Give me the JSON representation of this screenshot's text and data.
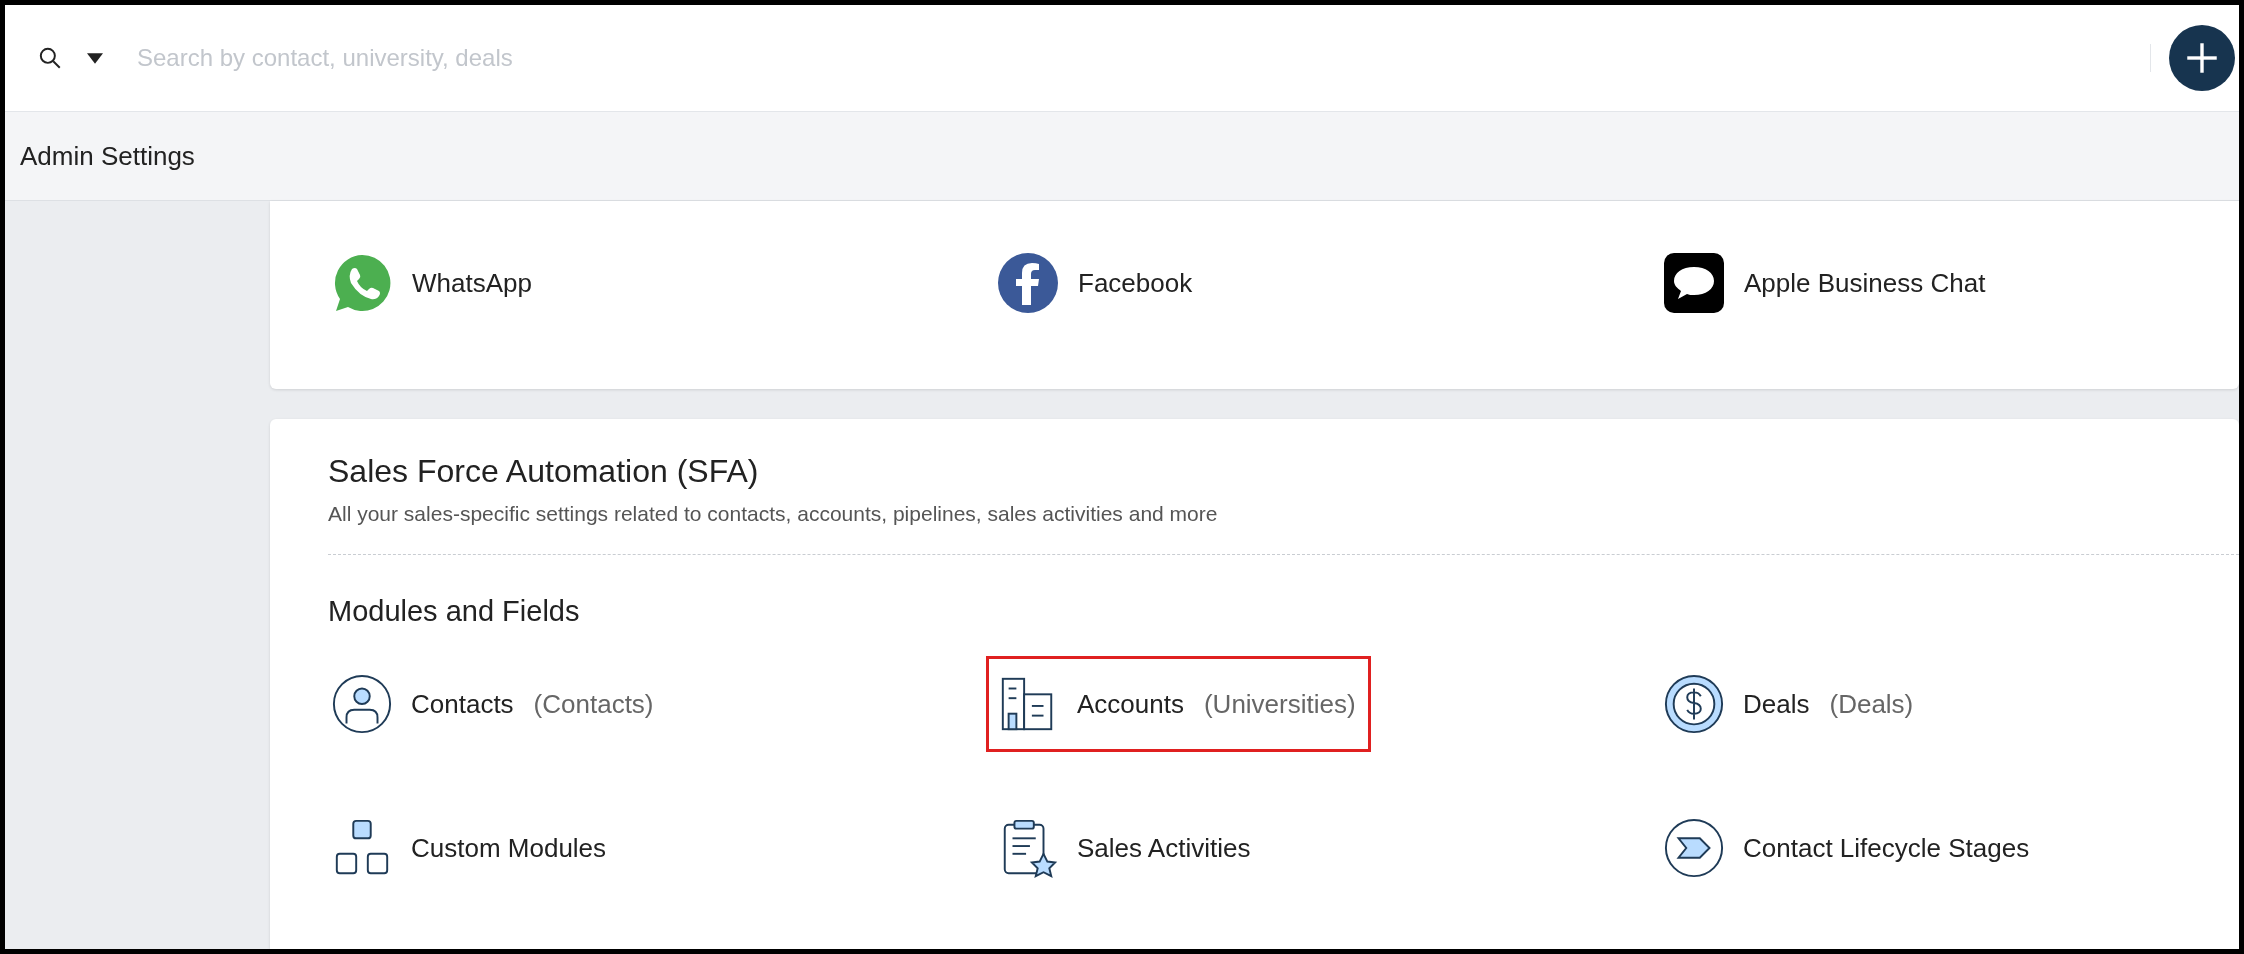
{
  "search": {
    "placeholder": "Search by contact, university, deals"
  },
  "header": {
    "title": "Admin Settings"
  },
  "channels": [
    {
      "label": "WhatsApp"
    },
    {
      "label": "Facebook"
    },
    {
      "label": "Apple Business Chat"
    }
  ],
  "section": {
    "title": "Sales Force Automation (SFA)",
    "subtitle": "All your sales-specific settings related to contacts, accounts, pipelines, sales activities and more",
    "group_title": "Modules and Fields",
    "modules": [
      {
        "label": "Contacts",
        "alias": "(Contacts)",
        "highlighted": false
      },
      {
        "label": "Accounts",
        "alias": "(Universities)",
        "highlighted": true
      },
      {
        "label": "Deals",
        "alias": "(Deals)",
        "highlighted": false
      },
      {
        "label": "Custom Modules",
        "highlighted": false
      },
      {
        "label": "Sales Activities",
        "highlighted": false
      },
      {
        "label": "Contact Lifecycle Stages",
        "highlighted": false
      }
    ]
  }
}
